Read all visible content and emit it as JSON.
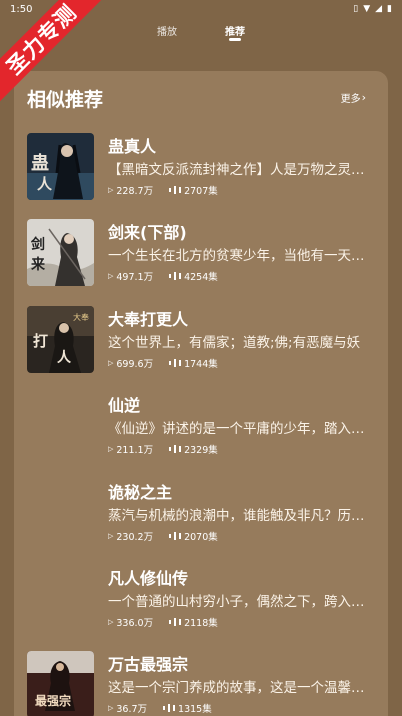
{
  "status_bar": {
    "time": "1:50"
  },
  "watermark": "圣力专测",
  "tabs": [
    {
      "label": "播放",
      "active": false
    },
    {
      "label": "推荐",
      "active": true
    }
  ],
  "section": {
    "title": "相似推荐",
    "more_label": "更多"
  },
  "books": [
    {
      "title": "蛊真人",
      "desc": "【黑暗文反派流封神之作】人是万物之灵，蛊是天地真精。三观不正，魔头重生。",
      "plays": "228.7万",
      "episodes": "2707集",
      "cover": "gu-zhen-ren"
    },
    {
      "title": "剑来(下部)",
      "desc": "一个生长在北方的贫寒少年，当他有一天离开家乡",
      "plays": "497.1万",
      "episodes": "4254集",
      "cover": "jian-lai"
    },
    {
      "title": "大奉打更人",
      "desc": "这个世界上，有儒家；道教;佛;有恶魔与妖",
      "plays": "699.6万",
      "episodes": "1744集",
      "cover": "da-feng-da-geng-ren"
    },
    {
      "title": "仙逆",
      "desc": "《仙逆》讲述的是一个平庸的少年，踏入修真之路",
      "plays": "211.1万",
      "episodes": "2329集",
      "cover": ""
    },
    {
      "title": "诡秘之主",
      "desc": "蒸汽与机械的浪潮中，谁能触及非凡？历史和黑暗",
      "plays": "230.2万",
      "episodes": "2070集",
      "cover": ""
    },
    {
      "title": "凡人修仙传",
      "desc": "一个普通的山村穷小子，偶然之下，跨入到一个江湖",
      "plays": "336.0万",
      "episodes": "2118集",
      "cover": ""
    },
    {
      "title": "万古最强宗",
      "desc": "这是一个宗门养成的故事，这是一个温馨的故事",
      "plays": "36.7万",
      "episodes": "1315集",
      "cover": "wan-gu-zui-qiang-zong"
    }
  ],
  "colors": {
    "background": "#7f6547",
    "panel": "#967b5c",
    "ribbon": "#e3262c"
  }
}
